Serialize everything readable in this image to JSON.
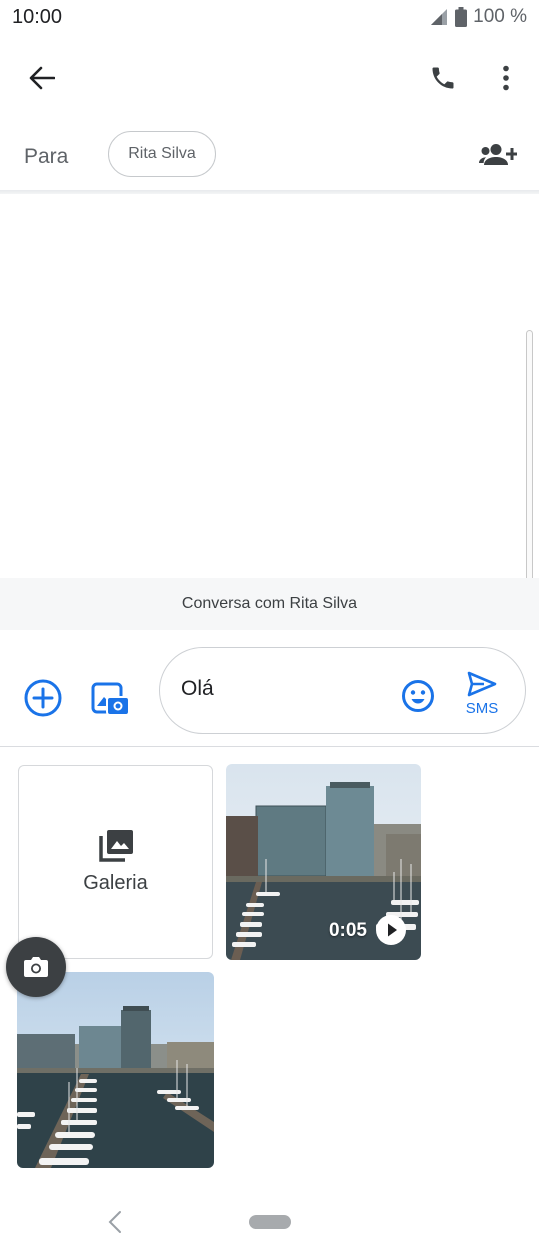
{
  "status_bar": {
    "time": "10:00",
    "battery": "100 %"
  },
  "toolbar": {
    "back_icon": "arrow-left-icon",
    "call_icon": "phone-icon",
    "more_icon": "more-vert-icon"
  },
  "recipient": {
    "label": "Para",
    "chip": "Rita Silva",
    "add_icon": "add-person-icon"
  },
  "conversation": {
    "banner": "Conversa com Rita Silva"
  },
  "compose": {
    "text": "Olá",
    "send_label": "SMS",
    "accent": "#1a73e8"
  },
  "media": {
    "gallery_label": "Galeria",
    "video_duration": "0:05"
  }
}
